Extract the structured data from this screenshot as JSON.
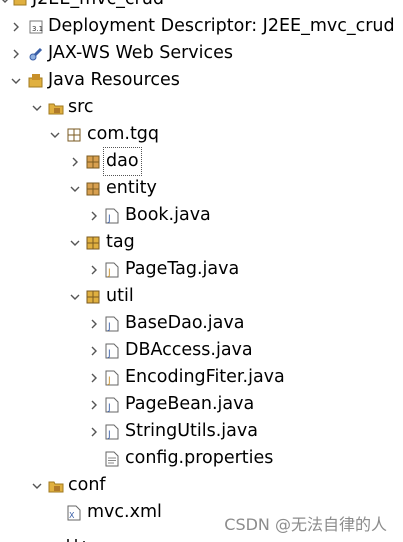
{
  "tree": {
    "project": "J2EE_mvc_crud",
    "deployment_descriptor": "Deployment Descriptor: J2EE_mvc_crud",
    "jaxws": "JAX-WS Web Services",
    "java_resources": "Java Resources",
    "src": "src",
    "pkg_root": "com.tgq",
    "dao": "dao",
    "entity": "entity",
    "book": "Book.java",
    "tag": "tag",
    "pagetag": "PageTag.java",
    "util": "util",
    "basedao": "BaseDao.java",
    "dbaccess": "DBAccess.java",
    "encoding": "EncodingFiter.java",
    "pagebean": "PageBean.java",
    "stringutils": "StringUtils.java",
    "config": "config.properties",
    "conf": "conf",
    "mvcxml": "mvc.xml"
  },
  "watermark": "CSDN @无法自律的人",
  "colors": {
    "folder": "#e0b040",
    "package": "#b07a2a",
    "java_file": "#3a5fa8",
    "twisty": "#555555"
  }
}
